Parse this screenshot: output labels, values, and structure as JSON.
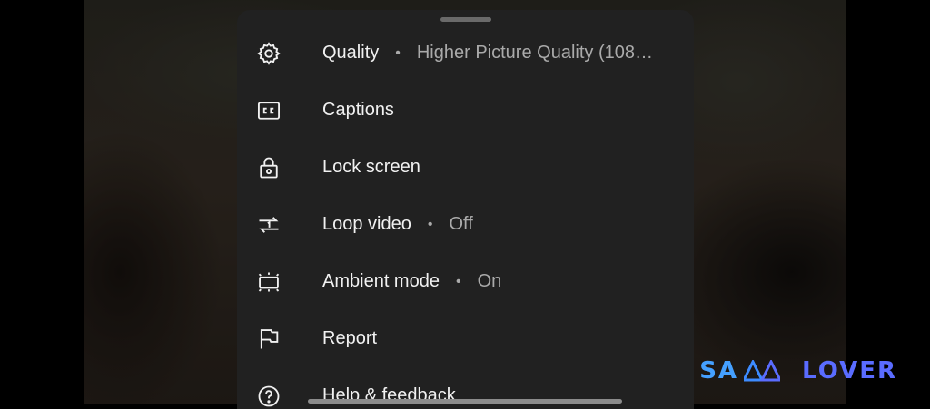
{
  "menu": {
    "items": [
      {
        "id": "quality",
        "label": "Quality",
        "value": "Higher Picture Quality (108…",
        "icon": "gear-icon"
      },
      {
        "id": "captions",
        "label": "Captions",
        "value": "",
        "icon": "cc-icon"
      },
      {
        "id": "lock",
        "label": "Lock screen",
        "value": "",
        "icon": "lock-icon"
      },
      {
        "id": "loop",
        "label": "Loop video",
        "value": "Off",
        "icon": "loop-icon"
      },
      {
        "id": "ambient",
        "label": "Ambient mode",
        "value": "On",
        "icon": "ambient-icon"
      },
      {
        "id": "report",
        "label": "Report",
        "value": "",
        "icon": "flag-icon"
      },
      {
        "id": "help",
        "label": "Help & feedback",
        "value": "",
        "icon": "help-icon"
      }
    ],
    "separator": "•"
  },
  "watermark": {
    "left": "SA",
    "right": "LOVER"
  },
  "colors": {
    "sheet": "#212121",
    "text": "#f1f1f1",
    "subtext": "#aaaaaa",
    "watermark": "#3d8bff"
  }
}
